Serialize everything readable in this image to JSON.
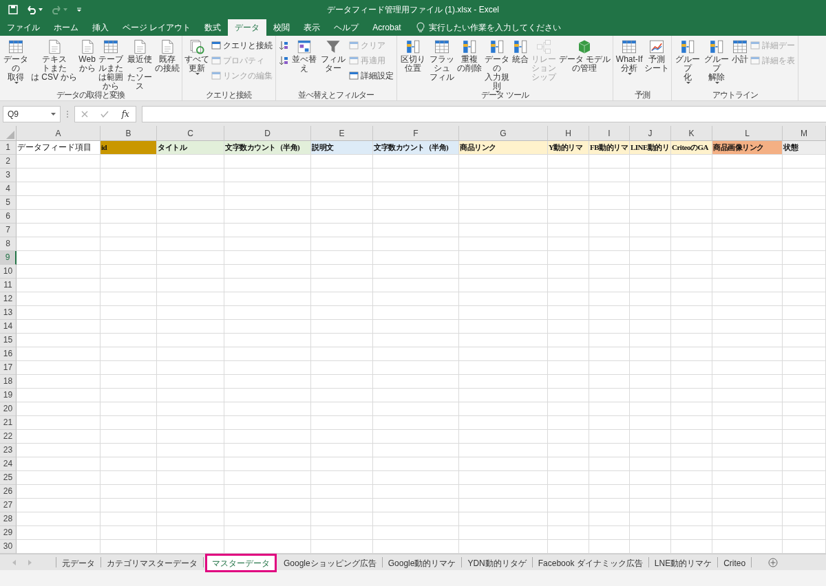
{
  "window": {
    "title": "データフィード管理用ファイル (1).xlsx  -  Excel"
  },
  "quick_access": [
    {
      "kind": "save",
      "disabled": false,
      "dropdown": false
    },
    {
      "kind": "undo",
      "disabled": false,
      "dropdown": true
    },
    {
      "kind": "redo",
      "disabled": true,
      "dropdown": true
    },
    {
      "kind": "customize",
      "disabled": false,
      "dropdown": false
    }
  ],
  "menu_tabs": [
    {
      "label": "ファイル",
      "selected": false
    },
    {
      "label": "ホーム",
      "selected": false
    },
    {
      "label": "挿入",
      "selected": false
    },
    {
      "label": "ページ レイアウト",
      "selected": false
    },
    {
      "label": "数式",
      "selected": false
    },
    {
      "label": "データ",
      "selected": true
    },
    {
      "label": "校閲",
      "selected": false
    },
    {
      "label": "表示",
      "selected": false
    },
    {
      "label": "ヘルプ",
      "selected": false
    },
    {
      "label": "Acrobat",
      "selected": false
    }
  ],
  "tell_me": {
    "placeholder": "実行したい作業を入力してください"
  },
  "ribbon_groups": [
    {
      "label": "データの取得と変換",
      "items": [
        {
          "kind": "large",
          "lines": [
            "データの",
            "取得"
          ],
          "dropdown": true,
          "disabled": false
        },
        {
          "kind": "large",
          "lines": [
            "テキストまた",
            "は CSV から"
          ],
          "dropdown": false,
          "disabled": false
        },
        {
          "kind": "large",
          "lines": [
            "Web",
            "から"
          ],
          "dropdown": false,
          "disabled": false
        },
        {
          "kind": "large",
          "lines": [
            "テーブルまた",
            "は範囲から"
          ],
          "dropdown": false,
          "disabled": false
        },
        {
          "kind": "large",
          "lines": [
            "最近使っ",
            "たソース"
          ],
          "dropdown": false,
          "disabled": false
        },
        {
          "kind": "large",
          "lines": [
            "既存",
            "の接続"
          ],
          "dropdown": false,
          "disabled": false
        }
      ]
    },
    {
      "label": "クエリと接続",
      "items": [
        {
          "kind": "large",
          "lines": [
            "すべて",
            "更新"
          ],
          "dropdown": true,
          "disabled": false
        },
        {
          "kind": "stack",
          "buttons": [
            {
              "label": "クエリと接続",
              "disabled": false
            },
            {
              "label": "プロパティ",
              "disabled": true
            },
            {
              "label": "リンクの編集",
              "disabled": true
            }
          ]
        }
      ]
    },
    {
      "label": "並べ替えとフィルター",
      "items": [
        {
          "kind": "stack",
          "buttons": [
            {
              "disabled": false
            },
            {
              "disabled": false
            }
          ]
        },
        {
          "kind": "large",
          "lines": [
            "並べ替え"
          ],
          "dropdown": false,
          "disabled": false
        },
        {
          "kind": "large",
          "lines": [
            "フィルター"
          ],
          "dropdown": false,
          "disabled": false
        },
        {
          "kind": "stack",
          "buttons": [
            {
              "label": "クリア",
              "disabled": true
            },
            {
              "label": "再適用",
              "disabled": true
            },
            {
              "label": "詳細設定",
              "disabled": false
            }
          ]
        }
      ]
    },
    {
      "label": "データ ツール",
      "items": [
        {
          "kind": "large",
          "lines": [
            "区切り位置"
          ],
          "dropdown": false,
          "disabled": false
        },
        {
          "kind": "large",
          "lines": [
            "フラッシュ",
            "フィル"
          ],
          "dropdown": false,
          "disabled": false
        },
        {
          "kind": "large",
          "lines": [
            "重複",
            "の削除"
          ],
          "dropdown": false,
          "disabled": false
        },
        {
          "kind": "large",
          "lines": [
            "データの",
            "入力規則"
          ],
          "dropdown": true,
          "disabled": false
        },
        {
          "kind": "large",
          "lines": [
            "統合"
          ],
          "dropdown": false,
          "disabled": false
        },
        {
          "kind": "large",
          "lines": [
            "リレーションシップ"
          ],
          "dropdown": false,
          "disabled": true
        },
        {
          "kind": "large",
          "lines": [
            "データ モデル",
            "の管理"
          ],
          "dropdown": false,
          "disabled": false
        }
      ]
    },
    {
      "label": "予測",
      "items": [
        {
          "kind": "large",
          "lines": [
            "What-If 分析"
          ],
          "dropdown": true,
          "disabled": false
        },
        {
          "kind": "large",
          "lines": [
            "予測",
            "シート"
          ],
          "dropdown": false,
          "disabled": false
        }
      ]
    },
    {
      "label": "アウトライン",
      "items": [
        {
          "kind": "large",
          "lines": [
            "グループ",
            "化"
          ],
          "dropdown": true,
          "disabled": false
        },
        {
          "kind": "large",
          "lines": [
            "グループ",
            "解除"
          ],
          "dropdown": true,
          "disabled": false
        },
        {
          "kind": "large",
          "lines": [
            "小計"
          ],
          "dropdown": false,
          "disabled": false
        },
        {
          "kind": "stack",
          "buttons": [
            {
              "label": "詳細デー",
              "disabled": true
            },
            {
              "label": "詳細を表",
              "disabled": true
            }
          ]
        }
      ]
    }
  ],
  "formula_bar": {
    "name_box": "Q9",
    "function_label": "fx"
  },
  "columns": [
    {
      "letter": "A",
      "row_1": "データフィード項目",
      "color": "#ffffff"
    },
    {
      "letter": "B",
      "row_1": "id",
      "color": "#c99700"
    },
    {
      "letter": "C",
      "row_1": "タイトル",
      "color": "#e2efda"
    },
    {
      "letter": "D",
      "row_1": "文字数カウント（半角)",
      "color": "#e2efda"
    },
    {
      "letter": "E",
      "row_1": "説明文",
      "color": "#ddebf7"
    },
    {
      "letter": "F",
      "row_1": "文字数カウント（半角)",
      "color": "#ddebf7"
    },
    {
      "letter": "G",
      "row_1": "商品リンク",
      "color": "#fff2cc"
    },
    {
      "letter": "H",
      "row_1": "Y動的リマ",
      "color": "#fff2cc"
    },
    {
      "letter": "I",
      "row_1": "FB動的リマ",
      "color": "#fff2cc"
    },
    {
      "letter": "J",
      "row_1": "LINE動的リ",
      "color": "#fff2cc"
    },
    {
      "letter": "K",
      "row_1": "CriteoのGA",
      "color": "#fff2cc"
    },
    {
      "letter": "L",
      "row_1": "商品画像リンク",
      "color": "#f4b084"
    },
    {
      "letter": "M",
      "row_1": "状態",
      "color": "#ededed"
    }
  ],
  "rows": [
    {
      "label": "1",
      "selected": false
    },
    {
      "label": "2",
      "selected": false
    },
    {
      "label": "3",
      "selected": false
    },
    {
      "label": "4",
      "selected": false
    },
    {
      "label": "5",
      "selected": false
    },
    {
      "label": "6",
      "selected": false
    },
    {
      "label": "7",
      "selected": false
    },
    {
      "label": "8",
      "selected": false
    },
    {
      "label": "9",
      "selected": true
    },
    {
      "label": "10",
      "selected": false
    },
    {
      "label": "11",
      "selected": false
    },
    {
      "label": "12",
      "selected": false
    },
    {
      "label": "13",
      "selected": false
    },
    {
      "label": "14",
      "selected": false
    },
    {
      "label": "15",
      "selected": false
    },
    {
      "label": "16",
      "selected": false
    },
    {
      "label": "17",
      "selected": false
    },
    {
      "label": "18",
      "selected": false
    },
    {
      "label": "19",
      "selected": false
    },
    {
      "label": "20",
      "selected": false
    },
    {
      "label": "21",
      "selected": false
    },
    {
      "label": "22",
      "selected": false
    },
    {
      "label": "23",
      "selected": false
    },
    {
      "label": "24",
      "selected": false
    },
    {
      "label": "25",
      "selected": false
    },
    {
      "label": "26",
      "selected": false
    },
    {
      "label": "27",
      "selected": false
    },
    {
      "label": "28",
      "selected": false
    },
    {
      "label": "29",
      "selected": false
    },
    {
      "label": "30",
      "selected": false
    }
  ],
  "sheet_tabs": [
    {
      "label": "元データ",
      "selected": false
    },
    {
      "label": "カテゴリマスターデータ",
      "selected": false
    },
    {
      "label": "マスターデータ",
      "selected": true
    },
    {
      "label": "Googleショッピング広告",
      "selected": false
    },
    {
      "label": "Google動的リマケ",
      "selected": false
    },
    {
      "label": "YDN動的リタゲ",
      "selected": false
    },
    {
      "label": "Facebook ダイナミック広告",
      "selected": false
    },
    {
      "label": "LNE動的リマケ",
      "selected": false
    },
    {
      "label": "Criteo",
      "selected": false
    }
  ]
}
